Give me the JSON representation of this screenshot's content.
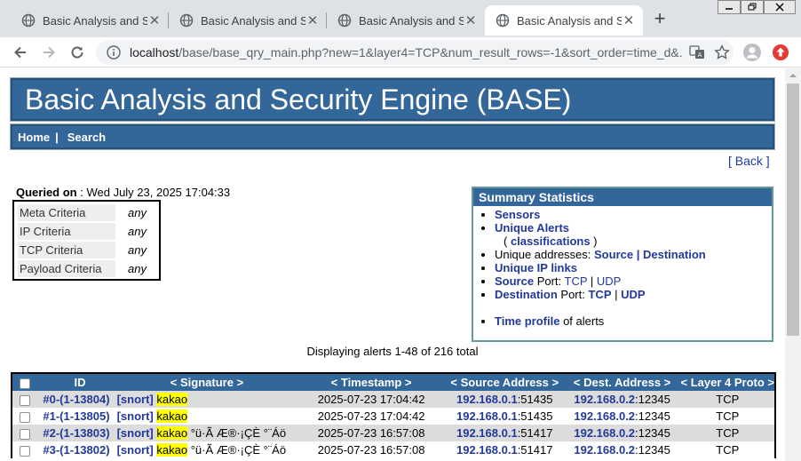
{
  "browser": {
    "tabs": [
      {
        "title": "Basic Analysis and Security Engine (BASE)",
        "active": false
      },
      {
        "title": "Basic Analysis and Security Engine (BASE)",
        "active": false
      },
      {
        "title": "Basic Analysis and Security Engine (BASE)",
        "active": false
      },
      {
        "title": "Basic Analysis and Security Engine (BASE)",
        "active": true
      }
    ],
    "url_host": "localhost",
    "url_rest": "/base/base_qry_main.php?new=1&layer4=TCP&num_result_rows=-1&sort_order=time_d&..."
  },
  "banner": {
    "title": "Basic Analysis and Security Engine (BASE)"
  },
  "menu": {
    "home": "Home",
    "sep": "|",
    "search": "Search"
  },
  "back": {
    "open": "[ ",
    "label": "Back",
    "close": " ]"
  },
  "query": {
    "label": "Queried on",
    "value": " : Wed July 23, 2025 17:04:33"
  },
  "criteria": [
    {
      "label": "Meta Criteria",
      "value": "any"
    },
    {
      "label": "IP Criteria",
      "value": "any"
    },
    {
      "label": "TCP Criteria",
      "value": "any"
    },
    {
      "label": "Payload Criteria",
      "value": "any"
    }
  ],
  "summary": {
    "title": "Summary Statistics",
    "sensors": "Sensors",
    "unique_alerts": "Unique Alerts",
    "paren_open": "( ",
    "classifications": "classifications",
    "paren_close": " )",
    "unique_addresses": "Unique addresses: ",
    "source": "Source",
    "pipe": " | ",
    "destination": "Destination",
    "unique_ip_links": "Unique IP links",
    "source_port": "Source",
    "port_word": " Port: ",
    "tcp": "TCP",
    "udp": "UDP",
    "dest_port": "Destination",
    "time_profile": "Time profile",
    "of_alerts": " of alerts"
  },
  "displaying": "Displaying alerts 1-48 of 216 total",
  "table": {
    "headers": {
      "id": "ID",
      "signature": "< Signature >",
      "timestamp": "< Timestamp >",
      "source": "< Source Address >",
      "dest": "< Dest. Address >",
      "proto": "< Layer 4 Proto >"
    },
    "rows": [
      {
        "id": "#0-(1-13804)",
        "tag": "[snort]",
        "sig": "kakao",
        "suffix": "",
        "ts": "2025-07-23 17:04:42",
        "src_ip": "192.168.0.1",
        "src_port": ":51435",
        "dst_ip": "192.168.0.2",
        "dst_port": ":12345",
        "proto": "TCP"
      },
      {
        "id": "#1-(1-13805)",
        "tag": "[snort]",
        "sig": "kakao",
        "suffix": "",
        "ts": "2025-07-23 17:04:42",
        "src_ip": "192.168.0.1",
        "src_port": ":51435",
        "dst_ip": "192.168.0.2",
        "dst_port": ":12345",
        "proto": "TCP"
      },
      {
        "id": "#2-(1-13803)",
        "tag": "[snort]",
        "sig": "kakao",
        "suffix": " °ü·Ã Æ®·¡ÇÈ °¨Áö",
        "ts": "2025-07-23 16:57:08",
        "src_ip": "192.168.0.1",
        "src_port": ":51417",
        "dst_ip": "192.168.0.2",
        "dst_port": ":12345",
        "proto": "TCP"
      },
      {
        "id": "#3-(1-13802)",
        "tag": "[snort]",
        "sig": "kakao",
        "suffix": " °ü·Ã Æ®·¡ÇÈ °¨Áö",
        "ts": "2025-07-23 16:57:08",
        "src_ip": "192.168.0.1",
        "src_port": ":51417",
        "dst_ip": "192.168.0.2",
        "dst_port": ":12345",
        "proto": "TCP"
      }
    ]
  }
}
